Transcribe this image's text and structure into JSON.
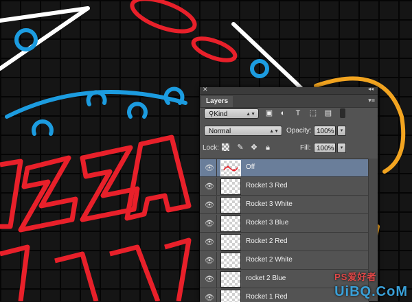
{
  "panel": {
    "title": "Layers",
    "filter": {
      "kind_label": "Kind"
    },
    "blend_mode": "Normal",
    "opacity_label": "Opacity:",
    "opacity_value": "100%",
    "lock_label": "Lock:",
    "fill_label": "Fill:",
    "fill_value": "100%",
    "layers": [
      {
        "name": "Off",
        "visible": true,
        "selected": true
      },
      {
        "name": "Rocket 3 Red",
        "visible": true,
        "selected": false
      },
      {
        "name": "Rocket 3 White",
        "visible": true,
        "selected": false
      },
      {
        "name": "Rocket 3 Blue",
        "visible": true,
        "selected": false
      },
      {
        "name": "Rocket 2 Red",
        "visible": true,
        "selected": false
      },
      {
        "name": "Rocket 2 White",
        "visible": true,
        "selected": false
      },
      {
        "name": "rocket 2 Blue",
        "visible": true,
        "selected": false
      },
      {
        "name": "Rocket 1 Red",
        "visible": true,
        "selected": false
      }
    ]
  },
  "watermark": {
    "brand": "UiBQ.CoM",
    "accent": "PS爱好者"
  },
  "colors": {
    "neon_red": "#e8202a",
    "neon_blue": "#1c9ce0",
    "neon_white": "#ffffff",
    "neon_orange": "#f2a420",
    "selected_row": "#6a7e9a"
  }
}
